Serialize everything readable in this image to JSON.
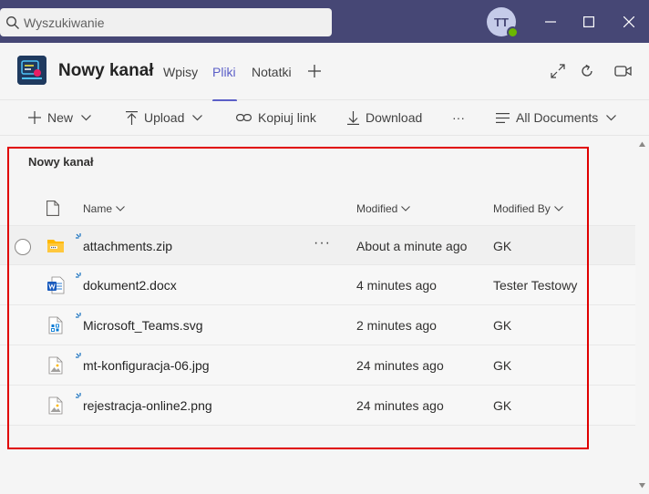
{
  "titlebar": {
    "search_placeholder": "Wyszukiwanie",
    "avatar_initials": "TT"
  },
  "channel": {
    "name": "Nowy kanał",
    "tabs": [
      {
        "label": "Wpisy",
        "active": false
      },
      {
        "label": "Pliki",
        "active": true
      },
      {
        "label": "Notatki",
        "active": false
      }
    ]
  },
  "toolbar": {
    "new_label": "New",
    "upload_label": "Upload",
    "copy_link_label": "Kopiuj link",
    "download_label": "Download",
    "more_label": "···",
    "view_label": "All Documents"
  },
  "library": {
    "title": "Nowy kanał",
    "columns": {
      "name": "Name",
      "modified": "Modified",
      "modified_by": "Modified By"
    },
    "files": [
      {
        "name": "attachments.zip",
        "modified": "About a minute ago",
        "modified_by": "GK",
        "icon": "zip-folder-icon"
      },
      {
        "name": "dokument2.docx",
        "modified": "4 minutes ago",
        "modified_by": "Tester Testowy",
        "icon": "word-doc-icon"
      },
      {
        "name": "Microsoft_Teams.svg",
        "modified": "2 minutes ago",
        "modified_by": "GK",
        "icon": "svg-file-icon"
      },
      {
        "name": "mt-konfiguracja-06.jpg",
        "modified": "24 minutes ago",
        "modified_by": "GK",
        "icon": "image-file-icon"
      },
      {
        "name": "rejestracja-online2.png",
        "modified": "24 minutes ago",
        "modified_by": "GK",
        "icon": "image-file-icon"
      }
    ],
    "row_more": "···"
  },
  "colors": {
    "titlebar": "#464775",
    "accent": "#5b5fc7",
    "highlight": "#e00000",
    "presence": "#6bb700"
  }
}
